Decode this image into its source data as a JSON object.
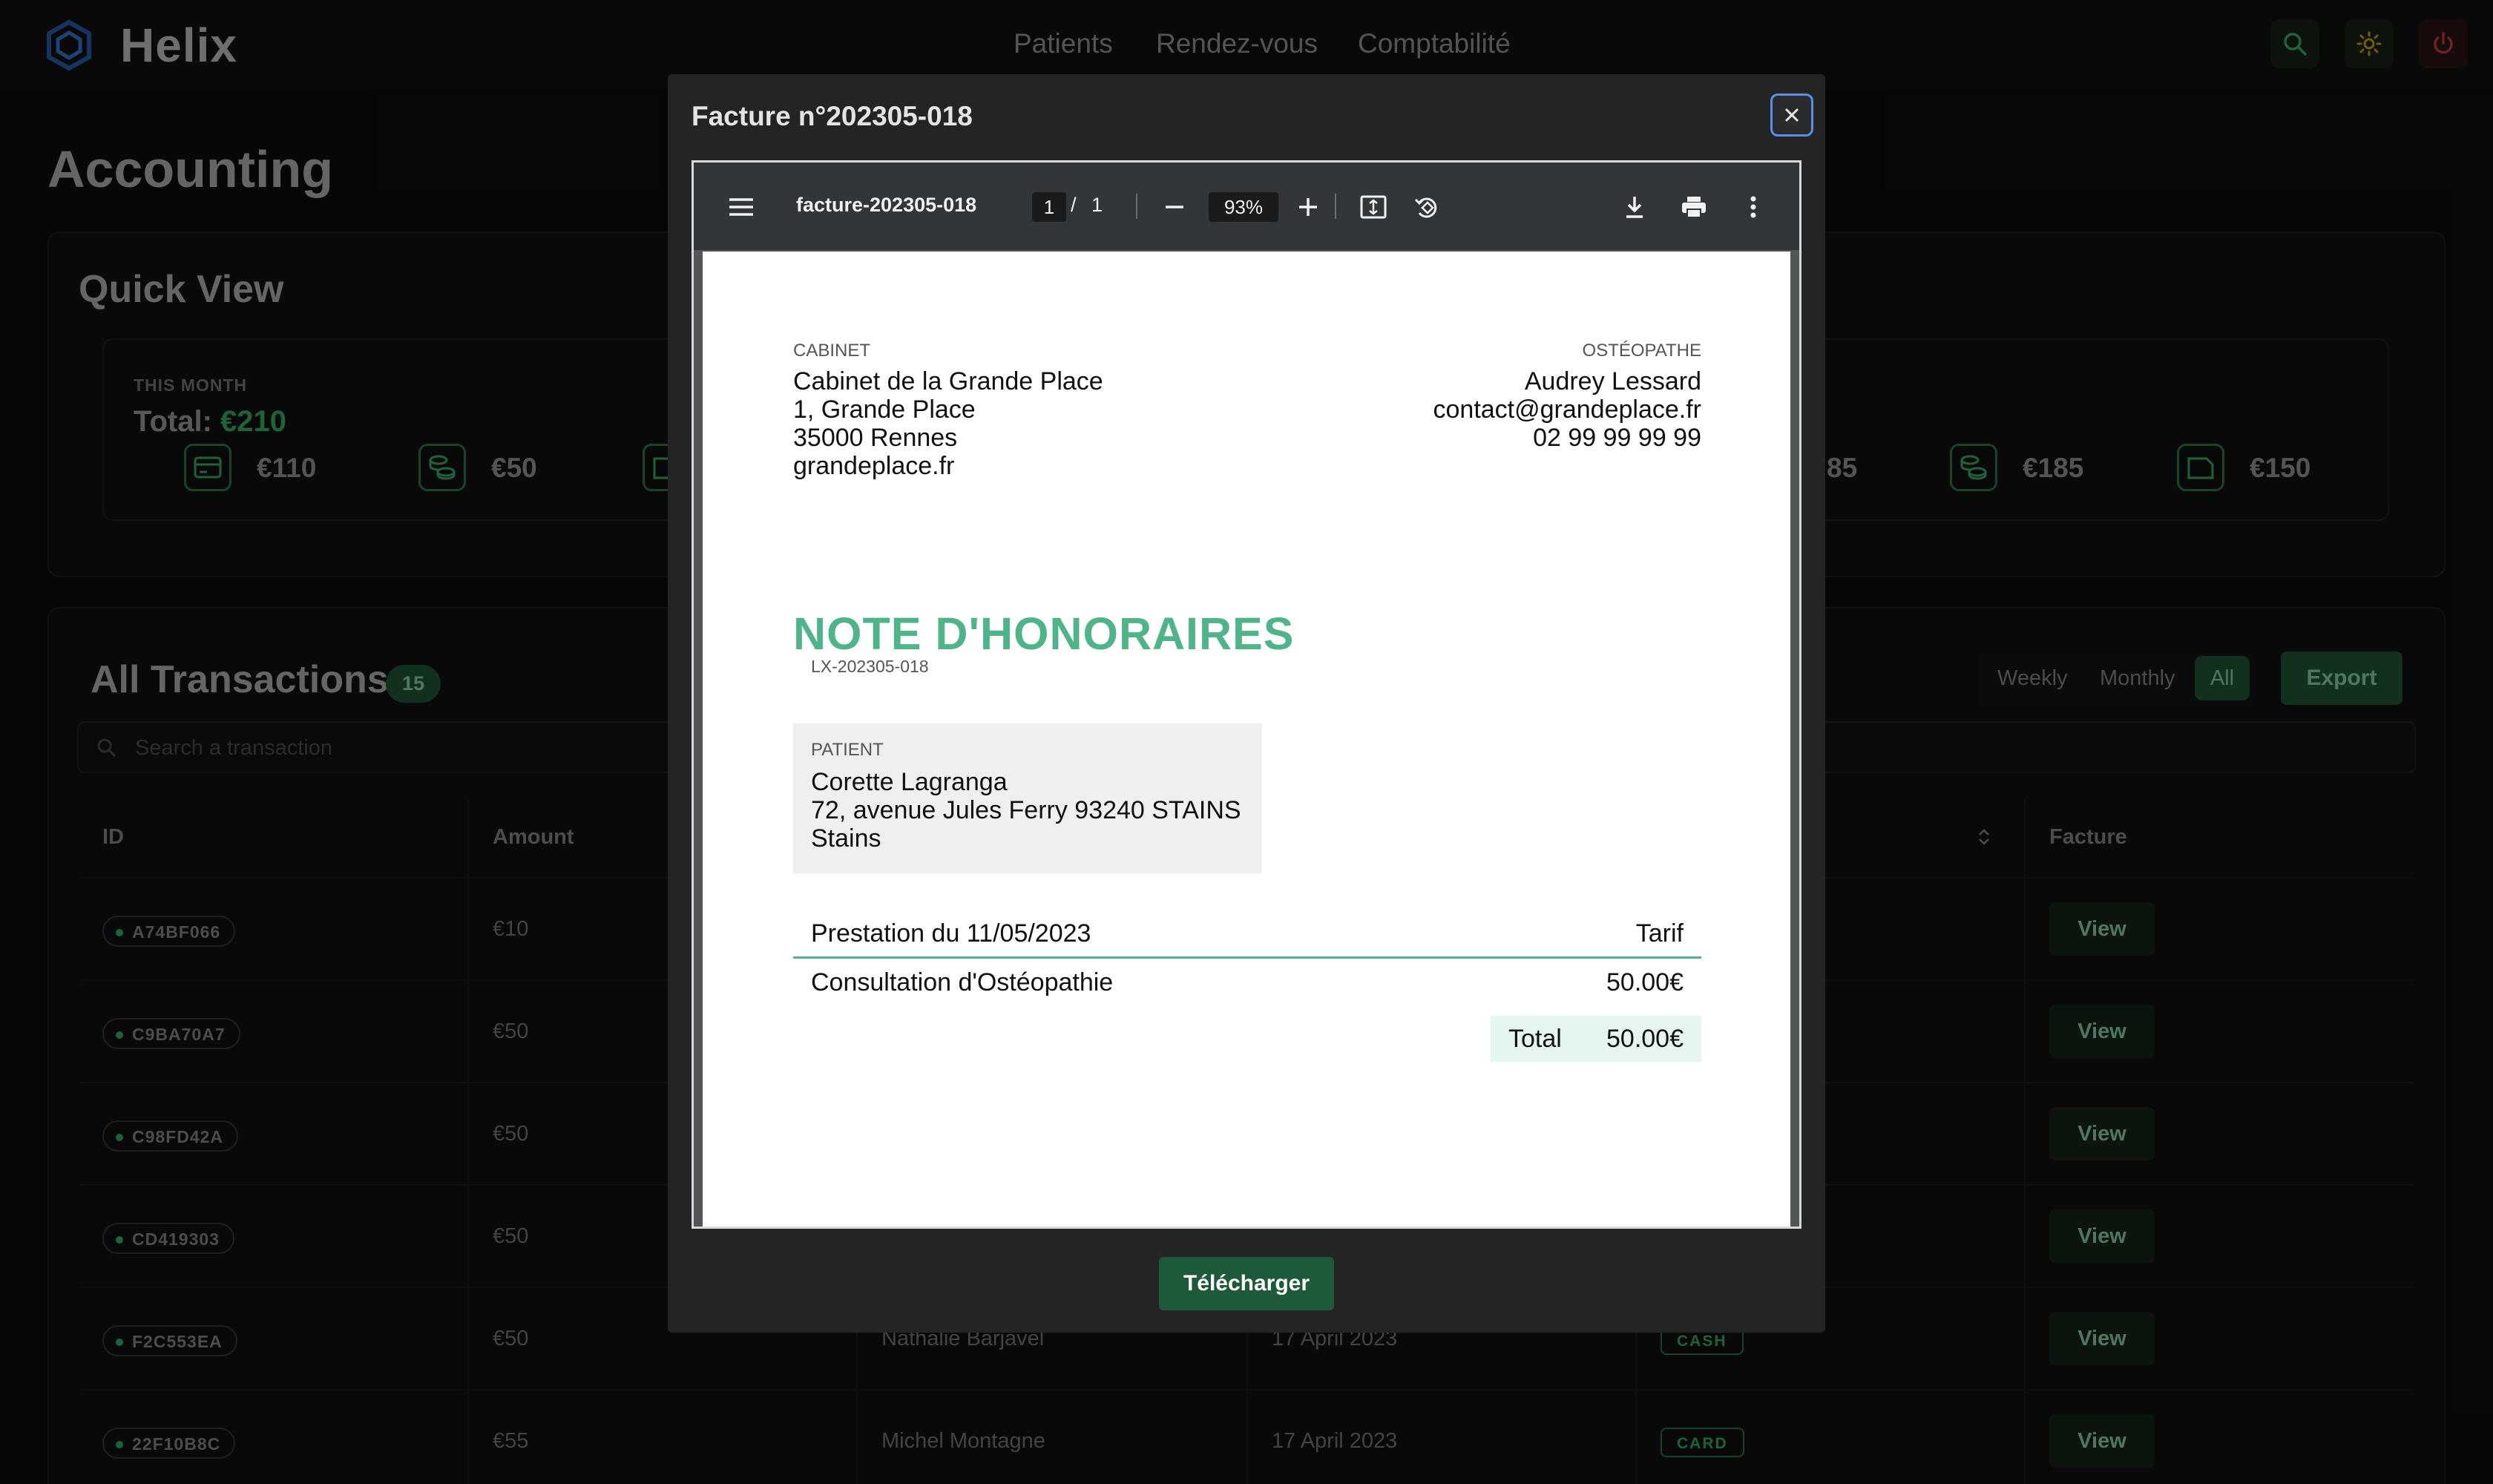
{
  "navbar": {
    "brand": "Helix",
    "links": [
      "Patients",
      "Rendez-vous",
      "Comptabilité"
    ]
  },
  "page": {
    "title": "Accounting"
  },
  "quick_view": {
    "title": "Quick View",
    "this_month": {
      "label": "THIS MONTH",
      "total_label": "Total:",
      "total_value": "€210",
      "card_amount": "€110",
      "cash_amount": "€50"
    },
    "right_box": {
      "partial_total": ")",
      "partial_amount": "85",
      "cash_amount": "€185",
      "check_amount": "€150"
    }
  },
  "transactions": {
    "title": "All Transactions",
    "count": "15",
    "filters": [
      "Weekly",
      "Monthly",
      "All"
    ],
    "export_label": "Export",
    "search_placeholder": "Search a transaction",
    "headers": {
      "id": "ID",
      "amount": "Amount",
      "facture": "Facture"
    },
    "view_label": "View",
    "rows": [
      {
        "id": "A74BF066",
        "amount": "€10"
      },
      {
        "id": "C9BA70A7",
        "amount": "€50"
      },
      {
        "id": "C98FD42A",
        "amount": "€50"
      },
      {
        "id": "CD419303",
        "amount": "€50"
      },
      {
        "id": "F2C553EA",
        "amount": "€50",
        "patient": "Nathalie Barjavel",
        "date": "17 April 2023",
        "type": "CASH"
      },
      {
        "id": "22F10B8C",
        "amount": "€55",
        "patient": "Michel Montagne",
        "date": "17 April 2023",
        "type": "CARD"
      }
    ]
  },
  "modal": {
    "title": "Facture n°202305-018",
    "download_label": "Télécharger",
    "viewer": {
      "file_name": "facture-202305-018",
      "page_current": "1",
      "page_sep": "/",
      "page_total": "1",
      "zoom": "93%"
    },
    "invoice": {
      "cabinet_label": "CABINET",
      "cabinet_lines": [
        "Cabinet de la Grande Place",
        "1, Grande Place",
        "35000 Rennes",
        "grandeplace.fr"
      ],
      "osteo_label": "OSTÉOPATHE",
      "osteo_lines": [
        "Audrey Lessard",
        "contact@grandeplace.fr",
        "02 99 99 99 99"
      ],
      "heading": "NOTE D'HONORAIRES",
      "reference": "LX-202305-018",
      "patient_label": "PATIENT",
      "patient_lines": [
        "Corette Lagranga",
        "72, avenue Jules Ferry 93240 STAINS",
        "Stains"
      ],
      "prestation_header": "Prestation du 11/05/2023",
      "tarif_header": "Tarif",
      "line_item": "Consultation d'Ostéopathie",
      "line_price": "50.00€",
      "total_label": "Total",
      "total_value": "50.00€"
    }
  }
}
